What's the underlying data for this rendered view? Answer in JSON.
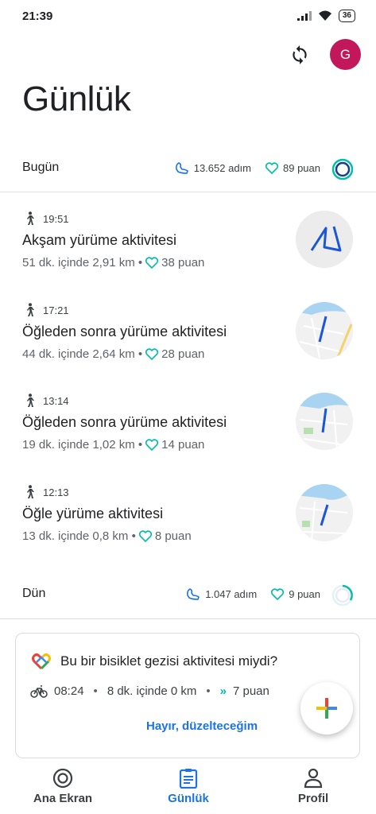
{
  "status_bar": {
    "time": "21:39",
    "battery": "36"
  },
  "header": {
    "title": "Günlük",
    "avatar_letter": "G"
  },
  "today": {
    "label": "Bugün",
    "steps": "13.652 adım",
    "points": "89 puan",
    "activities": [
      {
        "time": "19:51",
        "title": "Akşam yürüme aktivitesi",
        "meta": "51 dk. içinde 2,91 km •",
        "points": "38 puan"
      },
      {
        "time": "17:21",
        "title": "Öğleden sonra yürüme aktivitesi",
        "meta": "44 dk. içinde 2,64 km •",
        "points": "28 puan"
      },
      {
        "time": "13:14",
        "title": "Öğleden sonra yürüme aktivitesi",
        "meta": "19 dk. içinde 1,02 km •",
        "points": "14 puan"
      },
      {
        "time": "12:13",
        "title": "Öğle yürüme aktivitesi",
        "meta": "13 dk. içinde 0,8 km •",
        "points": "8 puan"
      }
    ]
  },
  "yesterday": {
    "label": "Dün",
    "steps": "1.047 adım",
    "points": "9 puan"
  },
  "suggestion_card": {
    "title": "Bu bir bisiklet gezisi aktivitesi miydi?",
    "time": "08:24",
    "duration": "8 dk. içinde 0 km",
    "points": "7 puan",
    "action": "Hayır, düzelteceğim"
  },
  "bottom_nav": {
    "home": "Ana Ekran",
    "journal": "Günlük",
    "profile": "Profil"
  },
  "colors": {
    "accent_blue": "#1a73e8",
    "heart_teal": "#00bfa5",
    "avatar": "#c2185b",
    "ring_blue": "#1a3d8f"
  },
  "icons": {
    "sync": "sync-icon",
    "walk": "walking-icon",
    "steps": "footsteps-icon",
    "heart": "heart-points-icon",
    "bike": "bike-icon",
    "add": "plus-icon"
  }
}
